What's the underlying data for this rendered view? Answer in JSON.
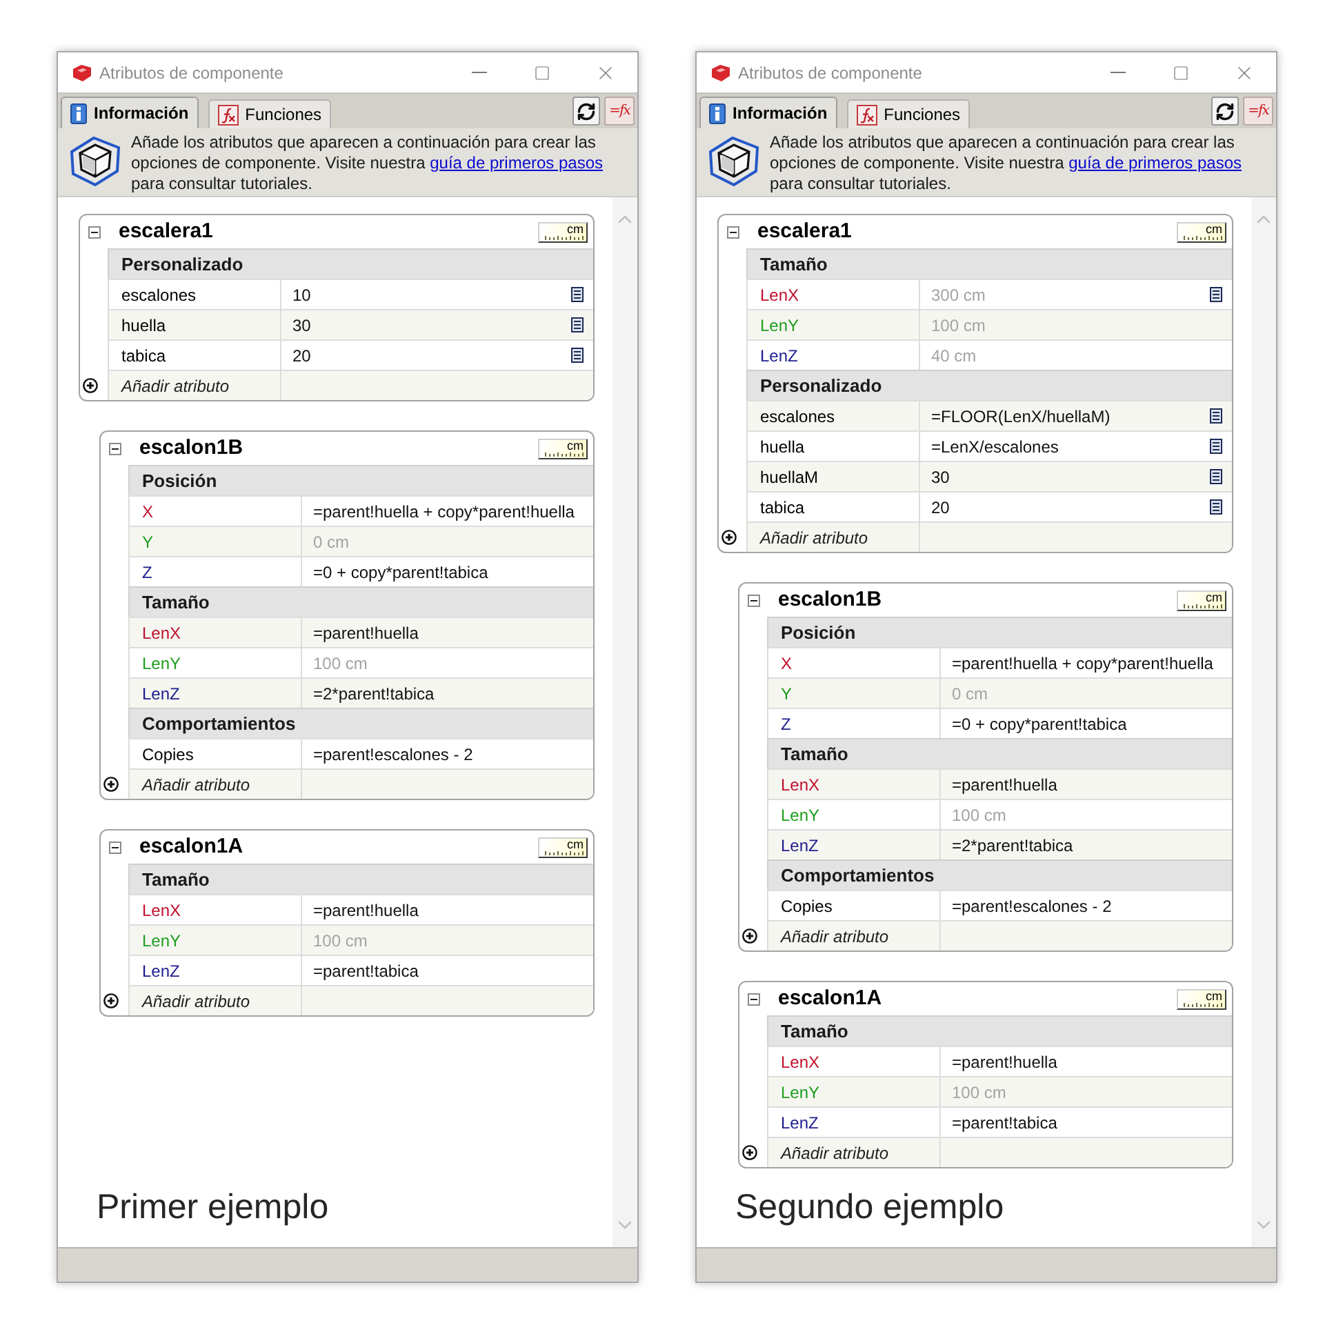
{
  "windows": [
    {
      "title": "Atributos de componente",
      "tabs": [
        {
          "label": "Información",
          "selected": true,
          "kind": "info"
        },
        {
          "label": "Funciones",
          "selected": false,
          "kind": "functions"
        }
      ],
      "formula_button": {
        "label": "=fx"
      },
      "banner": {
        "text": "Añade los atributos que aparecen a continuación para crear las opciones de componente. Visite nuestra",
        "link": "guía de primeros pasos",
        "text_after": "para consultar tutoriales."
      },
      "components": [
        {
          "name": "escalera1",
          "units": "cm",
          "expanded": true,
          "sections": [
            {
              "title": "Personalizado",
              "rows": [
                {
                  "name": "escalones",
                  "value": "10",
                  "color": "#000000",
                  "greyed": false,
                  "options": true
                },
                {
                  "name": "huella",
                  "value": "30",
                  "color": "#000000",
                  "greyed": false,
                  "options": true
                },
                {
                  "name": "tabica",
                  "value": "20",
                  "color": "#000000",
                  "greyed": false,
                  "options": true
                }
              ]
            }
          ],
          "add_label": "Añadir atributo",
          "children": [
            {
              "name": "escalon1B",
              "units": "cm",
              "expanded": true,
              "sections": [
                {
                  "title": "Posición",
                  "rows": [
                    {
                      "name": "X",
                      "value": "=parent!huella + copy*parent!huella",
                      "color": "#c0102c",
                      "greyed": false,
                      "options": false
                    },
                    {
                      "name": "Y",
                      "value": "0 cm",
                      "color": "#1e9e1e",
                      "greyed": true,
                      "options": false
                    },
                    {
                      "name": "Z",
                      "value": "=0 + copy*parent!tabica",
                      "color": "#1c1c8e",
                      "greyed": false,
                      "options": false
                    }
                  ]
                },
                {
                  "title": "Tamaño",
                  "rows": [
                    {
                      "name": "LenX",
                      "value": "=parent!huella",
                      "color": "#c0102c",
                      "greyed": false,
                      "options": false
                    },
                    {
                      "name": "LenY",
                      "value": "100 cm",
                      "color": "#1e9e1e",
                      "greyed": true,
                      "options": false
                    },
                    {
                      "name": "LenZ",
                      "value": "=2*parent!tabica",
                      "color": "#1c1c8e",
                      "greyed": false,
                      "options": false
                    }
                  ]
                },
                {
                  "title": "Comportamientos",
                  "rows": [
                    {
                      "name": "Copies",
                      "value": "=parent!escalones - 2",
                      "color": "#000000",
                      "greyed": false,
                      "options": false
                    }
                  ]
                }
              ],
              "add_label": "Añadir atributo"
            },
            {
              "name": "escalon1A",
              "units": "cm",
              "expanded": true,
              "sections": [
                {
                  "title": "Tamaño",
                  "rows": [
                    {
                      "name": "LenX",
                      "value": "=parent!huella",
                      "color": "#c0102c",
                      "greyed": false,
                      "options": false
                    },
                    {
                      "name": "LenY",
                      "value": "100 cm",
                      "color": "#1e9e1e",
                      "greyed": true,
                      "options": false
                    },
                    {
                      "name": "LenZ",
                      "value": "=parent!tabica",
                      "color": "#1c1c8e",
                      "greyed": false,
                      "options": false
                    }
                  ]
                }
              ],
              "add_label": "Añadir atributo"
            }
          ]
        }
      ],
      "caption": "Primer ejemplo"
    },
    {
      "title": "Atributos de componente",
      "tabs": [
        {
          "label": "Información",
          "selected": true,
          "kind": "info"
        },
        {
          "label": "Funciones",
          "selected": false,
          "kind": "functions"
        }
      ],
      "formula_button": {
        "label": "=fx"
      },
      "banner": {
        "text": "Añade los atributos que aparecen a continuación para crear las opciones de componente. Visite nuestra",
        "link": "guía de primeros pasos",
        "text_after": "para consultar tutoriales."
      },
      "components": [
        {
          "name": "escalera1",
          "units": "cm",
          "expanded": true,
          "sections": [
            {
              "title": "Tamaño",
              "rows": [
                {
                  "name": "LenX",
                  "value": "300 cm",
                  "color": "#c0102c",
                  "greyed": true,
                  "options": true
                },
                {
                  "name": "LenY",
                  "value": "100 cm",
                  "color": "#1e9e1e",
                  "greyed": true,
                  "options": false
                },
                {
                  "name": "LenZ",
                  "value": "40 cm",
                  "color": "#1c1c8e",
                  "greyed": true,
                  "options": false
                }
              ]
            },
            {
              "title": "Personalizado",
              "rows": [
                {
                  "name": "escalones",
                  "value": "=FLOOR(LenX/huellaM)",
                  "color": "#000000",
                  "greyed": false,
                  "options": true
                },
                {
                  "name": "huella",
                  "value": "=LenX/escalones",
                  "color": "#000000",
                  "greyed": false,
                  "options": true
                },
                {
                  "name": "huellaM",
                  "value": "30",
                  "color": "#000000",
                  "greyed": false,
                  "options": true
                },
                {
                  "name": "tabica",
                  "value": "20",
                  "color": "#000000",
                  "greyed": false,
                  "options": true
                }
              ]
            }
          ],
          "add_label": "Añadir atributo",
          "children": [
            {
              "name": "escalon1B",
              "units": "cm",
              "expanded": true,
              "sections": [
                {
                  "title": "Posición",
                  "rows": [
                    {
                      "name": "X",
                      "value": "=parent!huella + copy*parent!huella",
                      "color": "#c0102c",
                      "greyed": false,
                      "options": false
                    },
                    {
                      "name": "Y",
                      "value": "0 cm",
                      "color": "#1e9e1e",
                      "greyed": true,
                      "options": false
                    },
                    {
                      "name": "Z",
                      "value": "=0 + copy*parent!tabica",
                      "color": "#1c1c8e",
                      "greyed": false,
                      "options": false
                    }
                  ]
                },
                {
                  "title": "Tamaño",
                  "rows": [
                    {
                      "name": "LenX",
                      "value": "=parent!huella",
                      "color": "#c0102c",
                      "greyed": false,
                      "options": false
                    },
                    {
                      "name": "LenY",
                      "value": "100 cm",
                      "color": "#1e9e1e",
                      "greyed": true,
                      "options": false
                    },
                    {
                      "name": "LenZ",
                      "value": "=2*parent!tabica",
                      "color": "#1c1c8e",
                      "greyed": false,
                      "options": false
                    }
                  ]
                },
                {
                  "title": "Comportamientos",
                  "rows": [
                    {
                      "name": "Copies",
                      "value": "=parent!escalones - 2",
                      "color": "#000000",
                      "greyed": false,
                      "options": false
                    }
                  ]
                }
              ],
              "add_label": "Añadir atributo"
            },
            {
              "name": "escalon1A",
              "units": "cm",
              "expanded": true,
              "sections": [
                {
                  "title": "Tamaño",
                  "rows": [
                    {
                      "name": "LenX",
                      "value": "=parent!huella",
                      "color": "#c0102c",
                      "greyed": false,
                      "options": false
                    },
                    {
                      "name": "LenY",
                      "value": "100 cm",
                      "color": "#1e9e1e",
                      "greyed": true,
                      "options": false
                    },
                    {
                      "name": "LenZ",
                      "value": "=parent!tabica",
                      "color": "#1c1c8e",
                      "greyed": false,
                      "options": false
                    }
                  ]
                }
              ],
              "add_label": "Añadir atributo"
            }
          ]
        }
      ],
      "caption": "Segundo ejemplo"
    }
  ]
}
